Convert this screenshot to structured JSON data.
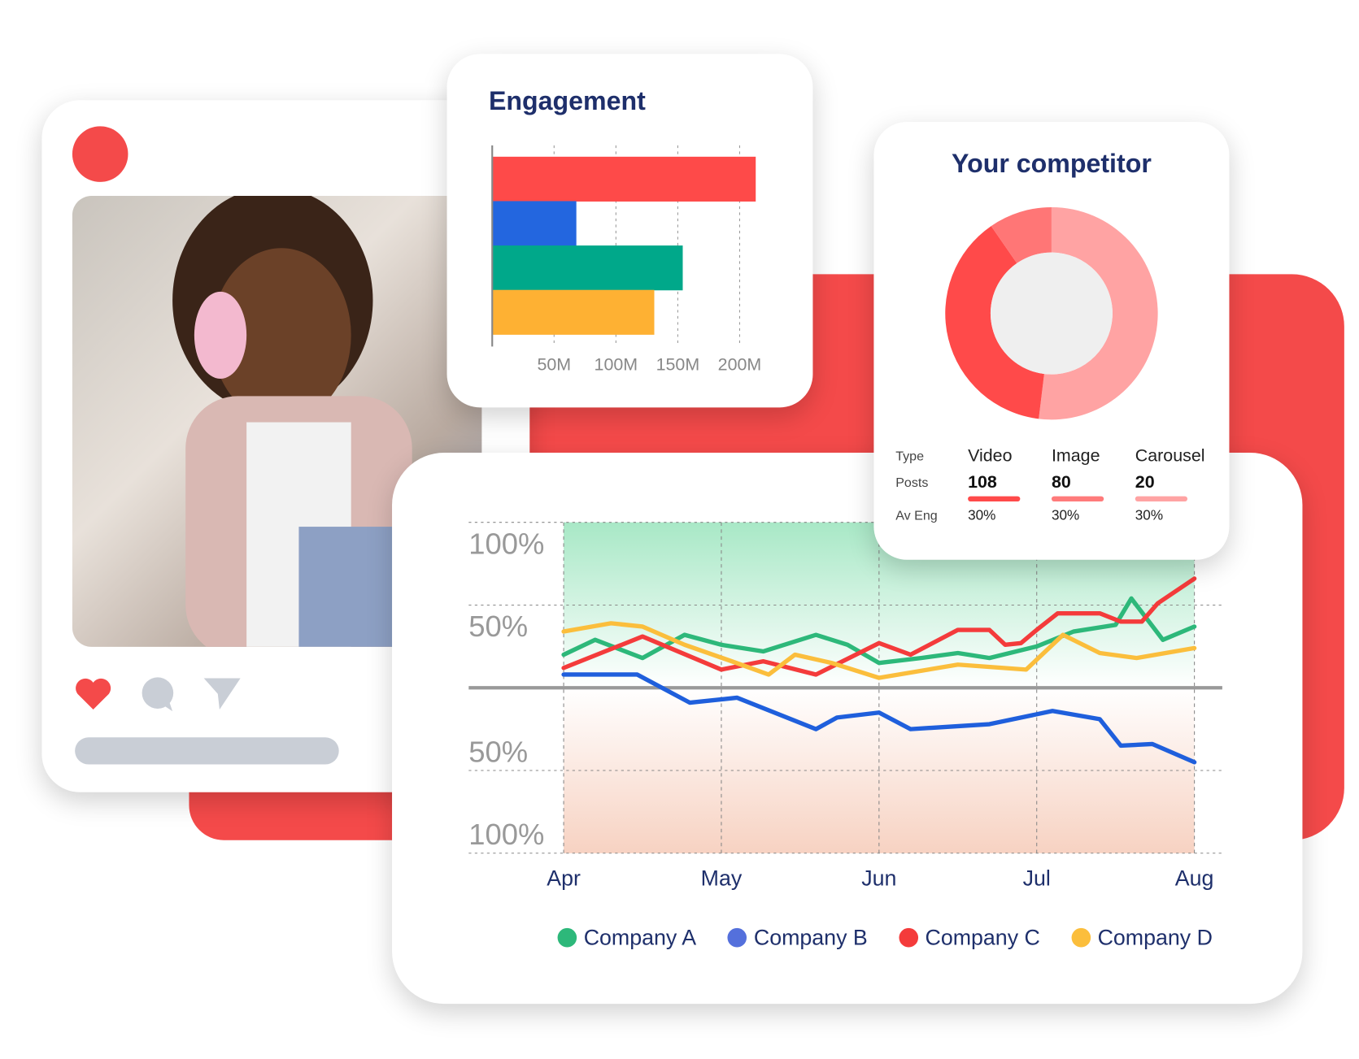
{
  "colors": {
    "accent": "#f44a4a",
    "navy": "#1e2f6b"
  },
  "social_post": {
    "icons": [
      "heart-icon",
      "comment-icon",
      "send-icon"
    ],
    "heart_color": "#f44a4a",
    "icon_color": "#c9ced6"
  },
  "engagement": {
    "title": "Engagement",
    "chart_data": {
      "type": "bar",
      "orientation": "horizontal",
      "title": "Engagement",
      "values_millions": [
        213,
        68,
        154,
        131
      ],
      "colors": [
        "#fe4a49",
        "#2366df",
        "#00a88a",
        "#feb133"
      ],
      "xticks": [
        "50M",
        "100M",
        "150M",
        "200M"
      ],
      "xtick_values": [
        50,
        100,
        150,
        200
      ],
      "xlim": [
        0,
        220
      ],
      "grid": "vertical dashed"
    }
  },
  "competitor": {
    "title": "Your competitor",
    "chart_data": {
      "type": "pie",
      "donut": true,
      "slices": [
        108,
        80,
        20
      ],
      "colors": [
        "#ffa3a3",
        "#ff4a4a",
        "#ff7676"
      ]
    },
    "row_labels": {
      "type": "Type",
      "posts": "Posts",
      "av_eng": "Av Eng"
    },
    "columns": [
      {
        "type": "Video",
        "posts": "108",
        "av_eng": "30%",
        "color": "#ff4a4a"
      },
      {
        "type": "Image",
        "posts": "80",
        "av_eng": "30%",
        "color": "#ff7b7b"
      },
      {
        "type": "Carousel",
        "posts": "20",
        "av_eng": "30%",
        "color": "#ffa3a3"
      }
    ]
  },
  "trend": {
    "chart_data": {
      "type": "line",
      "ylim": [
        -100,
        100
      ],
      "yticks": [
        100,
        50,
        -50,
        -100
      ],
      "ytick_labels": [
        "100%",
        "50%",
        "50%",
        "100%"
      ],
      "xticks": [
        "Apr",
        "May",
        "Jun",
        "Jul",
        "Aug"
      ],
      "grid": true,
      "legend": "bottom",
      "series": [
        {
          "name": "Company A",
          "color": "#2db87a",
          "points": [
            [
              "Apr 1",
              20
            ],
            [
              "Apr 7",
              29
            ],
            [
              "Apr 16",
              18
            ],
            [
              "Apr 24",
              32
            ],
            [
              "May 1",
              26
            ],
            [
              "May 9",
              22
            ],
            [
              "May 19",
              32
            ],
            [
              "May 25",
              26
            ],
            [
              "Jun 1",
              15
            ],
            [
              "Jun 9",
              18
            ],
            [
              "Jun 16",
              21
            ],
            [
              "Jun 22",
              18
            ],
            [
              "Jul 1",
              25
            ],
            [
              "Jul 8",
              34
            ],
            [
              "Jul 16",
              38
            ],
            [
              "Jul 19",
              54
            ],
            [
              "Jul 25",
              29
            ],
            [
              "Aug 1",
              37
            ]
          ]
        },
        {
          "name": "Company B",
          "color": "#1f5fdc",
          "points": [
            [
              "Apr 1",
              8
            ],
            [
              "Apr 15",
              8
            ],
            [
              "Apr 25",
              -9
            ],
            [
              "May 4",
              -6
            ],
            [
              "May 19",
              -25
            ],
            [
              "May 23",
              -18
            ],
            [
              "Jun 1",
              -15
            ],
            [
              "Jun 7",
              -25
            ],
            [
              "Jun 22",
              -22
            ],
            [
              "Jul 4",
              -14
            ],
            [
              "Jul 13",
              -19
            ],
            [
              "Jul 17",
              -35
            ],
            [
              "Jul 23",
              -34
            ],
            [
              "Aug 1",
              -45
            ]
          ]
        },
        {
          "name": "Company C",
          "color": "#f43b3b",
          "points": [
            [
              "Apr 1",
              12
            ],
            [
              "Apr 16",
              31
            ],
            [
              "May 1",
              11
            ],
            [
              "May 9",
              16
            ],
            [
              "May 19",
              8
            ],
            [
              "Jun 1",
              27
            ],
            [
              "Jun 7",
              20
            ],
            [
              "Jun 16",
              35
            ],
            [
              "Jun 22",
              35
            ],
            [
              "Jun 25",
              26
            ],
            [
              "Jun 28",
              27
            ],
            [
              "Jul 1",
              35
            ],
            [
              "Jul 5",
              45
            ],
            [
              "Jul 13",
              45
            ],
            [
              "Jul 17",
              40
            ],
            [
              "Jul 21",
              40
            ],
            [
              "Jul 24",
              51
            ],
            [
              "Aug 1",
              66
            ]
          ]
        },
        {
          "name": "Company D",
          "color": "#fbbe3c",
          "points": [
            [
              "Apr 1",
              34
            ],
            [
              "Apr 10",
              39
            ],
            [
              "Apr 16",
              37
            ],
            [
              "Apr 24",
              26
            ],
            [
              "May 3",
              16
            ],
            [
              "May 10",
              8
            ],
            [
              "May 15",
              20
            ],
            [
              "May 22",
              15
            ],
            [
              "Jun 1",
              6
            ],
            [
              "Jun 16",
              14
            ],
            [
              "Jun 29",
              11
            ],
            [
              "Jul 6",
              32
            ],
            [
              "Jul 13",
              21
            ],
            [
              "Jul 20",
              18
            ],
            [
              "Aug 1",
              24
            ]
          ]
        }
      ]
    },
    "legend": [
      {
        "label": "Company A",
        "color": "#2db87a"
      },
      {
        "label": "Company B",
        "color": "#5470dc"
      },
      {
        "label": "Company C",
        "color": "#f43b3b"
      },
      {
        "label": "Company D",
        "color": "#fbbe3c"
      }
    ]
  }
}
